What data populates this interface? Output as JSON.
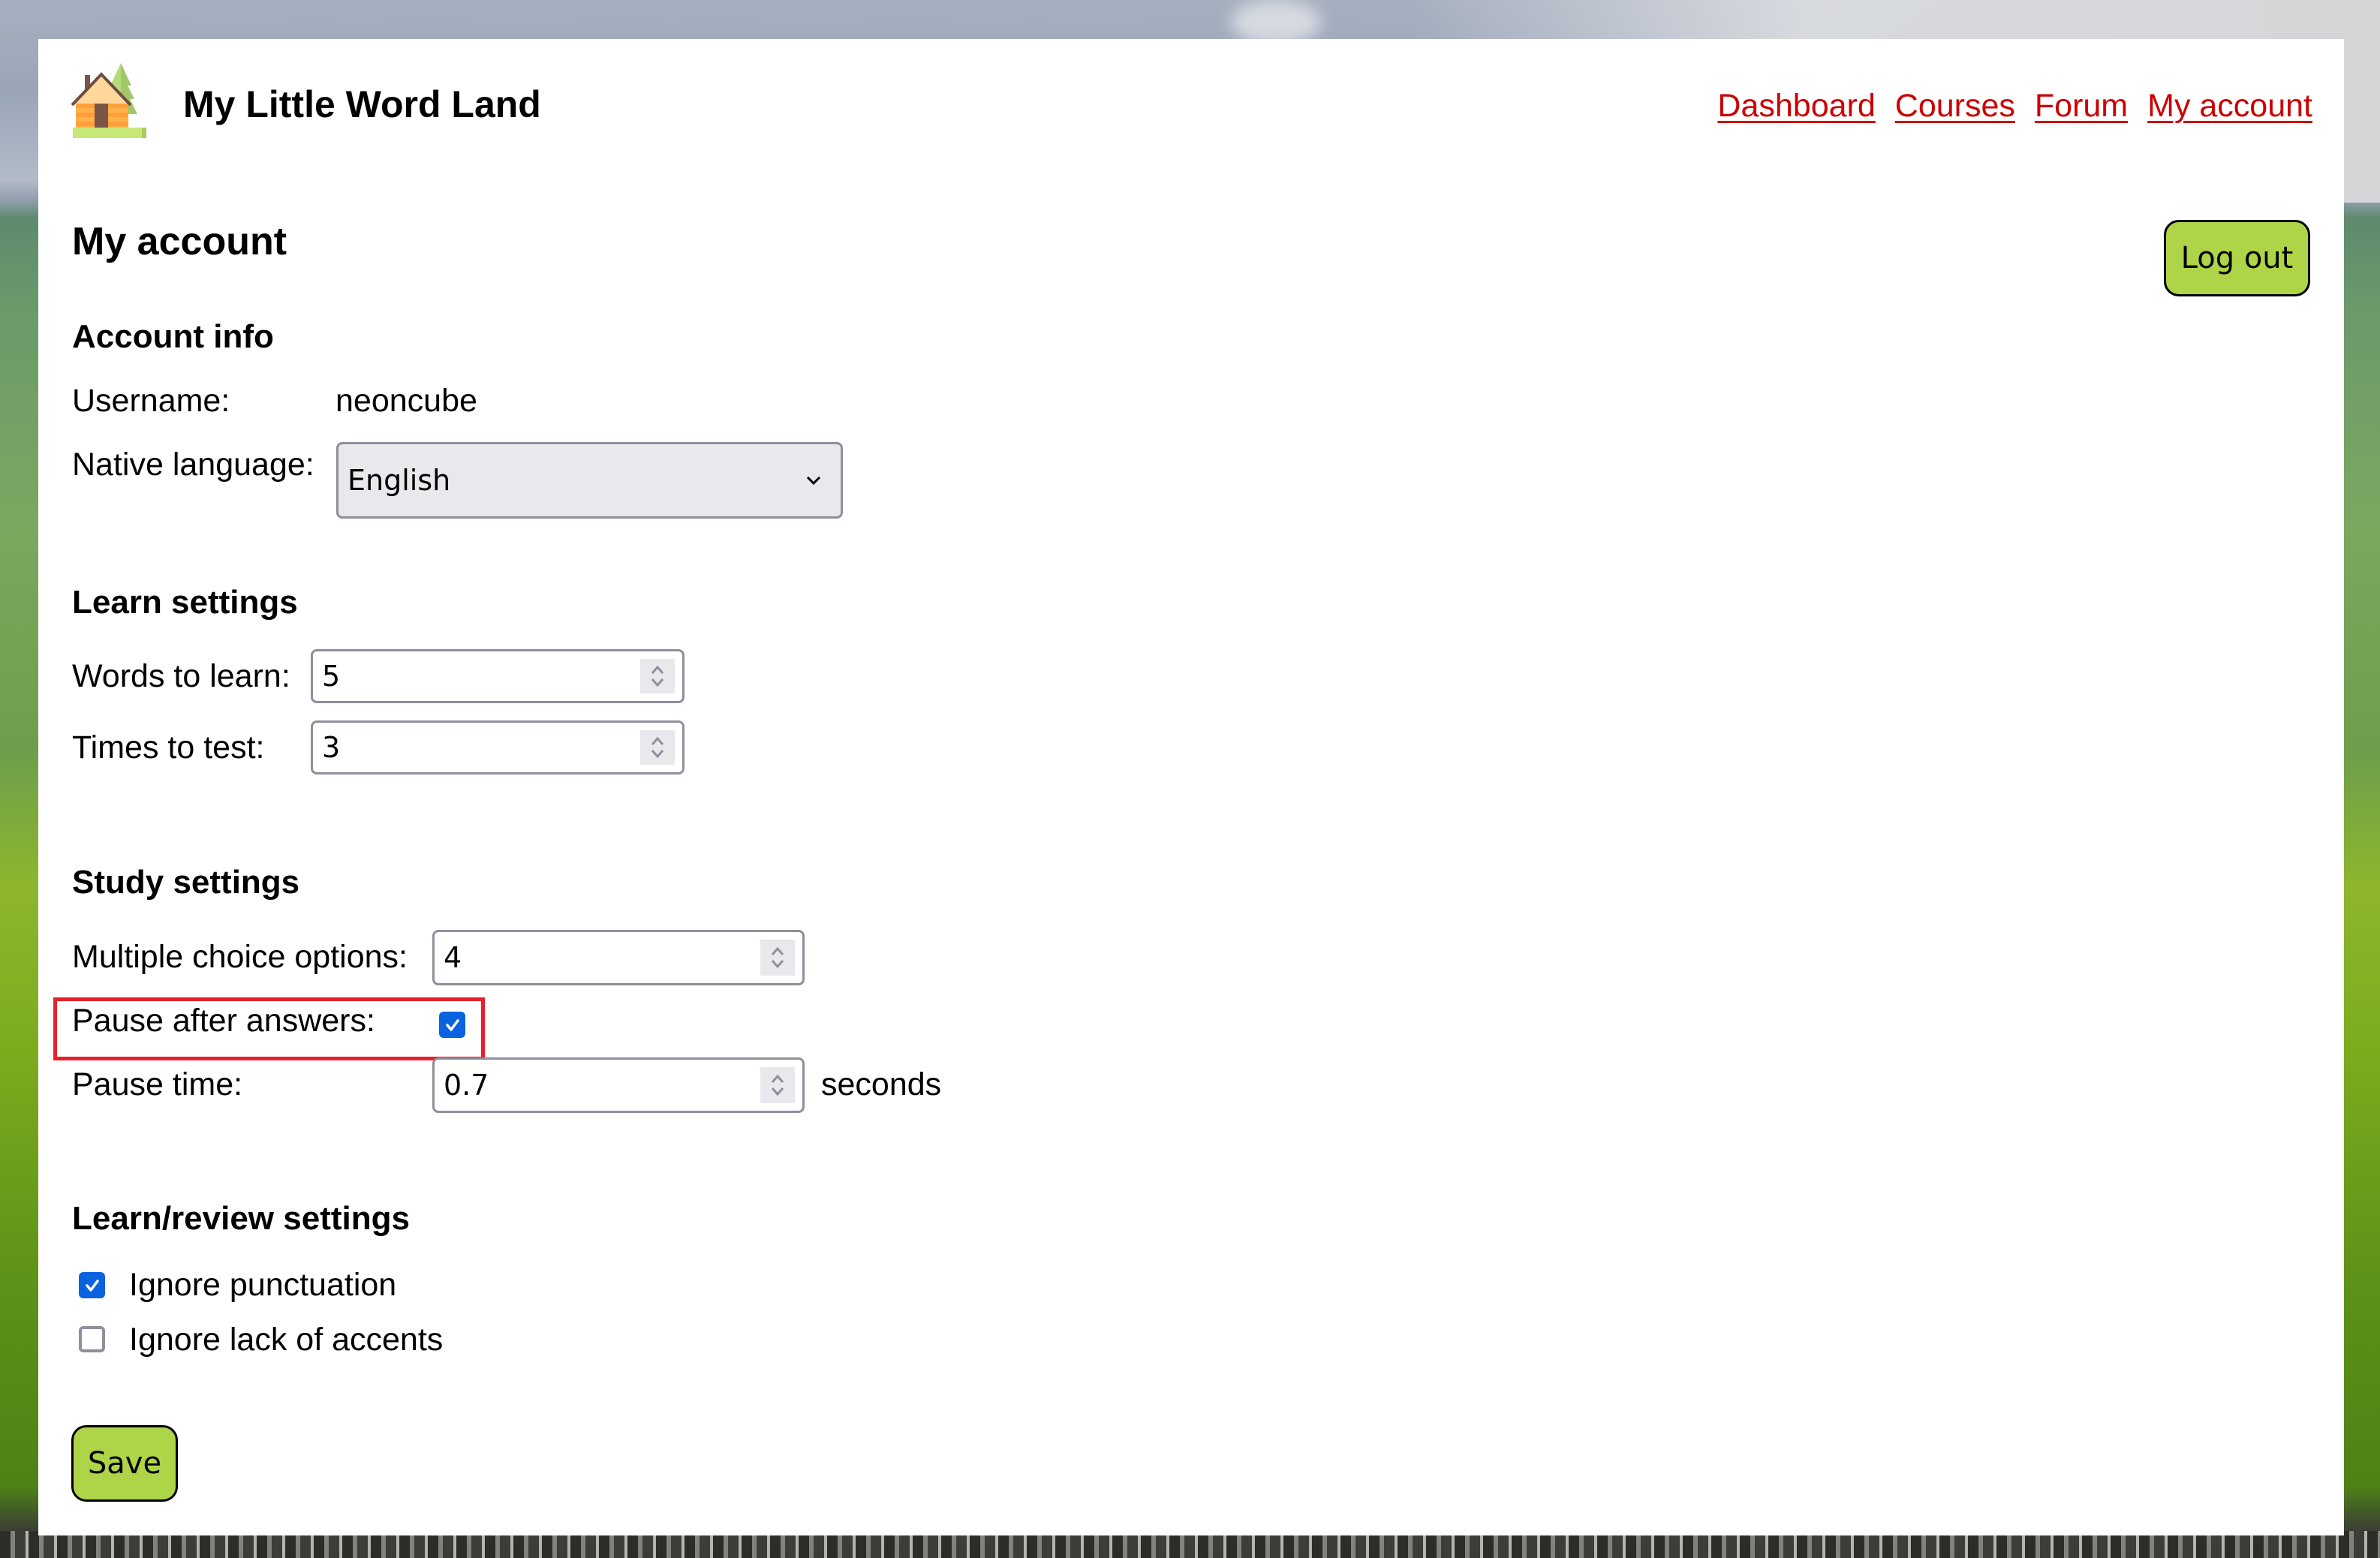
{
  "header": {
    "logo_icon": "cabin-with-tree-icon",
    "site_title": "My Little Word Land",
    "nav": [
      {
        "label": "Dashboard"
      },
      {
        "label": "Courses"
      },
      {
        "label": "Forum"
      },
      {
        "label": "My account"
      }
    ]
  },
  "page": {
    "title": "My account",
    "logout_label": "Log out",
    "save_label": "Save"
  },
  "account_info": {
    "heading": "Account info",
    "username_label": "Username:",
    "username_value": "neoncube",
    "native_language_label": "Native language:",
    "native_language_value": "English"
  },
  "learn_settings": {
    "heading": "Learn settings",
    "words_to_learn_label": "Words to learn:",
    "words_to_learn_value": "5",
    "times_to_test_label": "Times to test:",
    "times_to_test_value": "3"
  },
  "study_settings": {
    "heading": "Study settings",
    "multiple_choice_label": "Multiple choice options:",
    "multiple_choice_value": "4",
    "pause_after_answers_label": "Pause after answers:",
    "pause_after_answers_checked": true,
    "pause_time_label": "Pause time:",
    "pause_time_value": "0.7",
    "pause_time_unit": "seconds"
  },
  "learn_review_settings": {
    "heading": "Learn/review settings",
    "options": [
      {
        "label": "Ignore punctuation",
        "checked": true
      },
      {
        "label": "Ignore lack of accents",
        "checked": false
      }
    ]
  },
  "colors": {
    "accent_button": "#aed447",
    "link": "#cc0000",
    "checkbox": "#0b62e0",
    "highlight": "#e8202a"
  }
}
